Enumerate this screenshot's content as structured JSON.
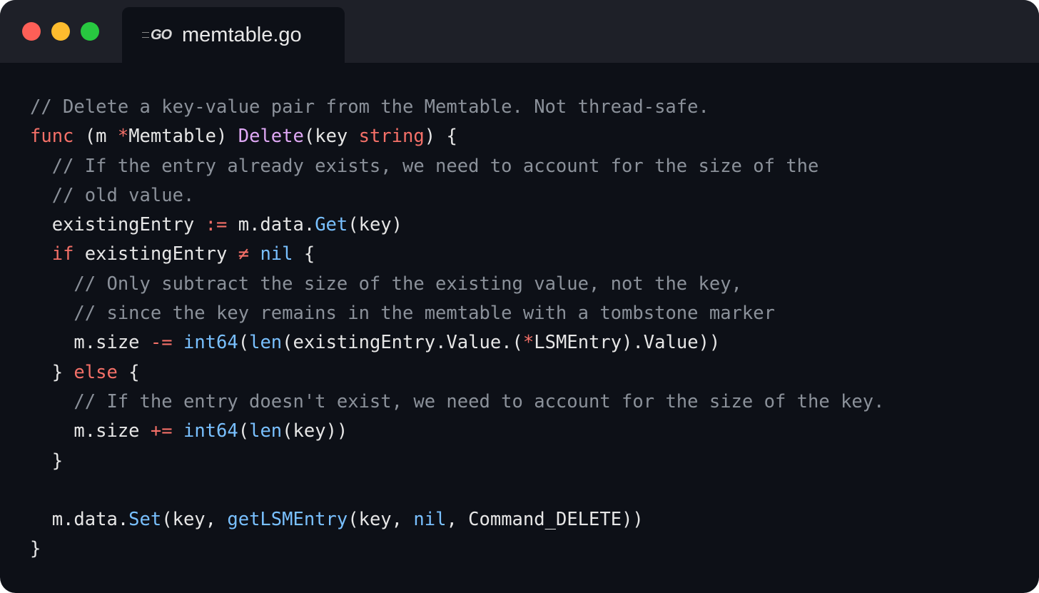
{
  "window": {
    "traffic_lights": [
      "close",
      "minimize",
      "zoom"
    ],
    "tab": {
      "icon": "go-logo-icon",
      "icon_text": "GO",
      "title": "memtable.go"
    }
  },
  "colors": {
    "background": "#0d1017",
    "titlebar": "#1e2028",
    "comment": "#8b919a",
    "keyword": "#f47068",
    "function_name": "#dfa8f5",
    "builtin_call": "#79c0ff",
    "default": "#e6e6e6"
  },
  "code": {
    "language": "go",
    "lines": [
      [
        {
          "t": "c",
          "v": "// Delete a key-value pair from the Memtable. Not thread-safe."
        }
      ],
      [
        {
          "t": "k",
          "v": "func"
        },
        {
          "t": "d",
          "v": " (m "
        },
        {
          "t": "k",
          "v": "*"
        },
        {
          "t": "d",
          "v": "Memtable) "
        },
        {
          "t": "p",
          "v": "Delete"
        },
        {
          "t": "d",
          "v": "(key "
        },
        {
          "t": "k",
          "v": "string"
        },
        {
          "t": "d",
          "v": ") {"
        }
      ],
      [
        {
          "t": "d",
          "v": "  "
        },
        {
          "t": "c",
          "v": "// If the entry already exists, we need to account for the size of the"
        }
      ],
      [
        {
          "t": "d",
          "v": "  "
        },
        {
          "t": "c",
          "v": "// old value."
        }
      ],
      [
        {
          "t": "d",
          "v": "  existingEntry "
        },
        {
          "t": "k",
          "v": ":="
        },
        {
          "t": "d",
          "v": " m.data."
        },
        {
          "t": "f",
          "v": "Get"
        },
        {
          "t": "d",
          "v": "(key)"
        }
      ],
      [
        {
          "t": "d",
          "v": "  "
        },
        {
          "t": "k",
          "v": "if"
        },
        {
          "t": "d",
          "v": " existingEntry "
        },
        {
          "t": "k",
          "v": "≠"
        },
        {
          "t": "d",
          "v": " "
        },
        {
          "t": "f",
          "v": "nil"
        },
        {
          "t": "d",
          "v": " {"
        }
      ],
      [
        {
          "t": "d",
          "v": "    "
        },
        {
          "t": "c",
          "v": "// Only subtract the size of the existing value, not the key,"
        }
      ],
      [
        {
          "t": "d",
          "v": "    "
        },
        {
          "t": "c",
          "v": "// since the key remains in the memtable with a tombstone marker"
        }
      ],
      [
        {
          "t": "d",
          "v": "    m.size "
        },
        {
          "t": "k",
          "v": "-="
        },
        {
          "t": "d",
          "v": " "
        },
        {
          "t": "f",
          "v": "int64"
        },
        {
          "t": "d",
          "v": "("
        },
        {
          "t": "f",
          "v": "len"
        },
        {
          "t": "d",
          "v": "(existingEntry.Value.("
        },
        {
          "t": "k",
          "v": "*"
        },
        {
          "t": "d",
          "v": "LSMEntry).Value))"
        }
      ],
      [
        {
          "t": "d",
          "v": "  } "
        },
        {
          "t": "k",
          "v": "else"
        },
        {
          "t": "d",
          "v": " {"
        }
      ],
      [
        {
          "t": "d",
          "v": "    "
        },
        {
          "t": "c",
          "v": "// If the entry doesn't exist, we need to account for the size of the key."
        }
      ],
      [
        {
          "t": "d",
          "v": "    m.size "
        },
        {
          "t": "k",
          "v": "+="
        },
        {
          "t": "d",
          "v": " "
        },
        {
          "t": "f",
          "v": "int64"
        },
        {
          "t": "d",
          "v": "("
        },
        {
          "t": "f",
          "v": "len"
        },
        {
          "t": "d",
          "v": "(key))"
        }
      ],
      [
        {
          "t": "d",
          "v": "  }"
        }
      ],
      [
        {
          "t": "d",
          "v": ""
        }
      ],
      [
        {
          "t": "d",
          "v": "  m.data."
        },
        {
          "t": "f",
          "v": "Set"
        },
        {
          "t": "d",
          "v": "(key, "
        },
        {
          "t": "f",
          "v": "getLSMEntry"
        },
        {
          "t": "d",
          "v": "(key, "
        },
        {
          "t": "f",
          "v": "nil"
        },
        {
          "t": "d",
          "v": ", Command_DELETE))"
        }
      ],
      [
        {
          "t": "d",
          "v": "}"
        }
      ]
    ]
  }
}
